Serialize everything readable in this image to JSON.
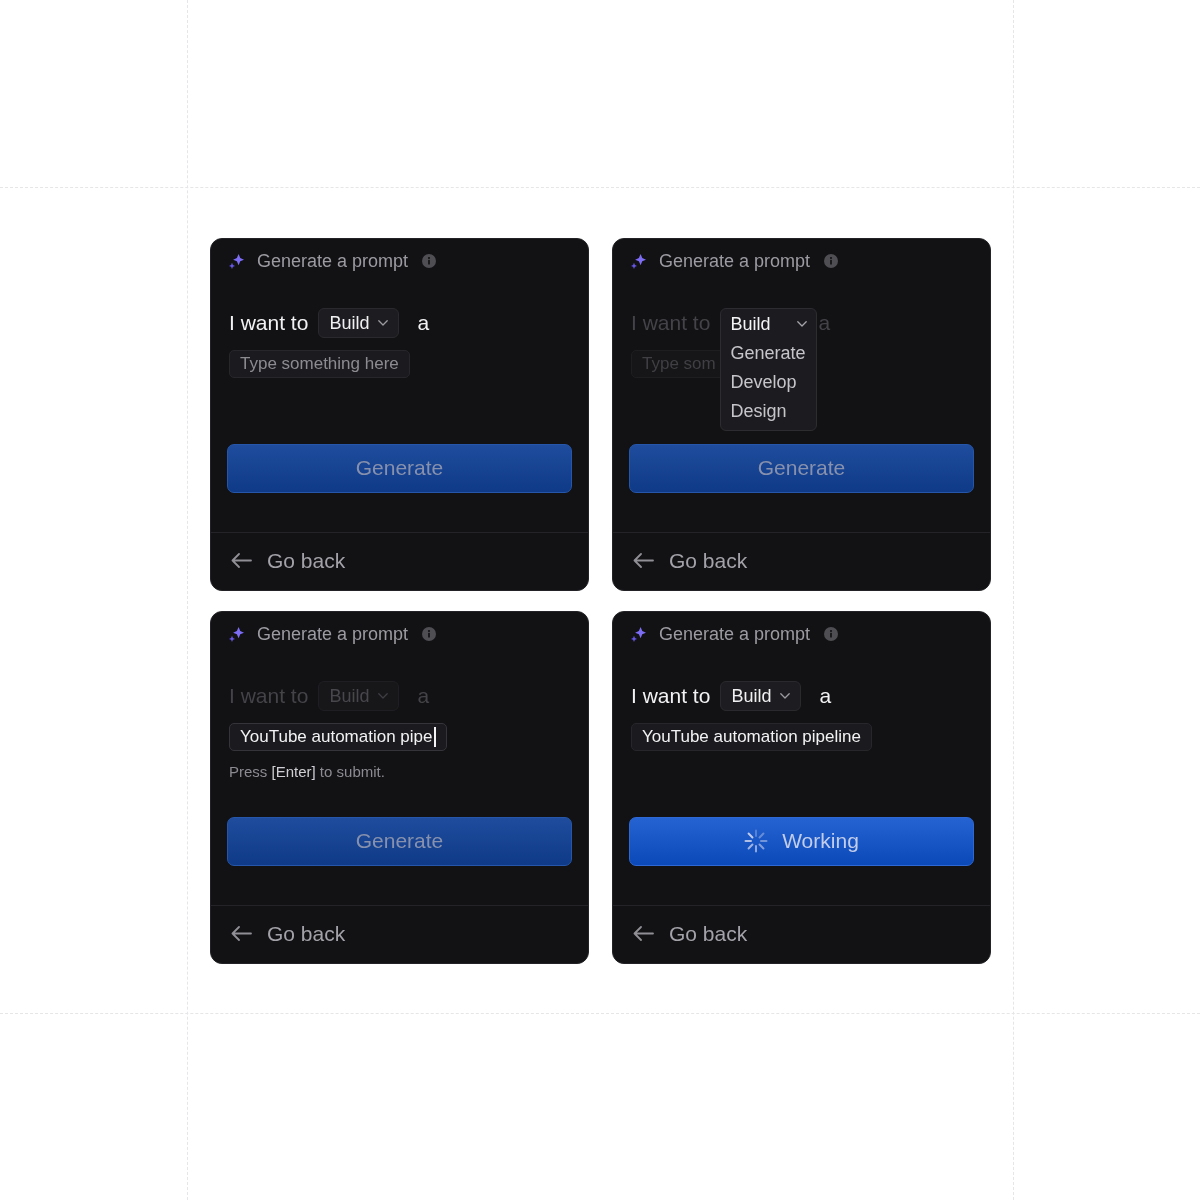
{
  "cards": [
    {
      "header": {
        "title": "Generate a prompt"
      },
      "sentence": {
        "lead": "I want to",
        "dropdown": {
          "value": "Build",
          "expanded": false
        },
        "tail": "a",
        "dimmed": false
      },
      "input": {
        "placeholder": "Type something here",
        "focused": false,
        "dimmed": false
      },
      "button": {
        "label": "Generate",
        "disabled": true,
        "loading": false
      },
      "footer": {
        "label": "Go back"
      }
    },
    {
      "header": {
        "title": "Generate a prompt"
      },
      "sentence": {
        "lead": "I want to",
        "dropdown": {
          "value": "Build",
          "expanded": true,
          "options": [
            {
              "label": "Generate",
              "selected": false
            },
            {
              "label": "Develop",
              "selected": false
            },
            {
              "label": "Design",
              "selected": false
            }
          ]
        },
        "tail": "a",
        "dimmed": true
      },
      "input": {
        "placeholder": "Type som",
        "focused": false,
        "dimmed": true
      },
      "button": {
        "label": "Generate",
        "disabled": true,
        "loading": false
      },
      "footer": {
        "label": "Go back"
      }
    },
    {
      "header": {
        "title": "Generate a prompt"
      },
      "sentence": {
        "lead": "I want to",
        "dropdown": {
          "value": "Build",
          "expanded": false
        },
        "tail": "a",
        "dimmed": true
      },
      "input": {
        "value": "YouTube automation pipe",
        "focused": true,
        "dimmed": false
      },
      "hint": "Press **[Enter]** to submit.",
      "button": {
        "label": "Generate",
        "disabled": true,
        "loading": false
      },
      "footer": {
        "label": "Go back"
      }
    },
    {
      "header": {
        "title": "Generate a prompt"
      },
      "sentence": {
        "lead": "I want to",
        "dropdown": {
          "value": "Build",
          "expanded": false
        },
        "tail": "a",
        "dimmed": false
      },
      "input": {
        "value": "YouTube automation pipeline",
        "focused": false,
        "dimmed": false
      },
      "button": {
        "label": "Working",
        "disabled": false,
        "loading": true
      },
      "footer": {
        "label": "Go back"
      }
    }
  ]
}
